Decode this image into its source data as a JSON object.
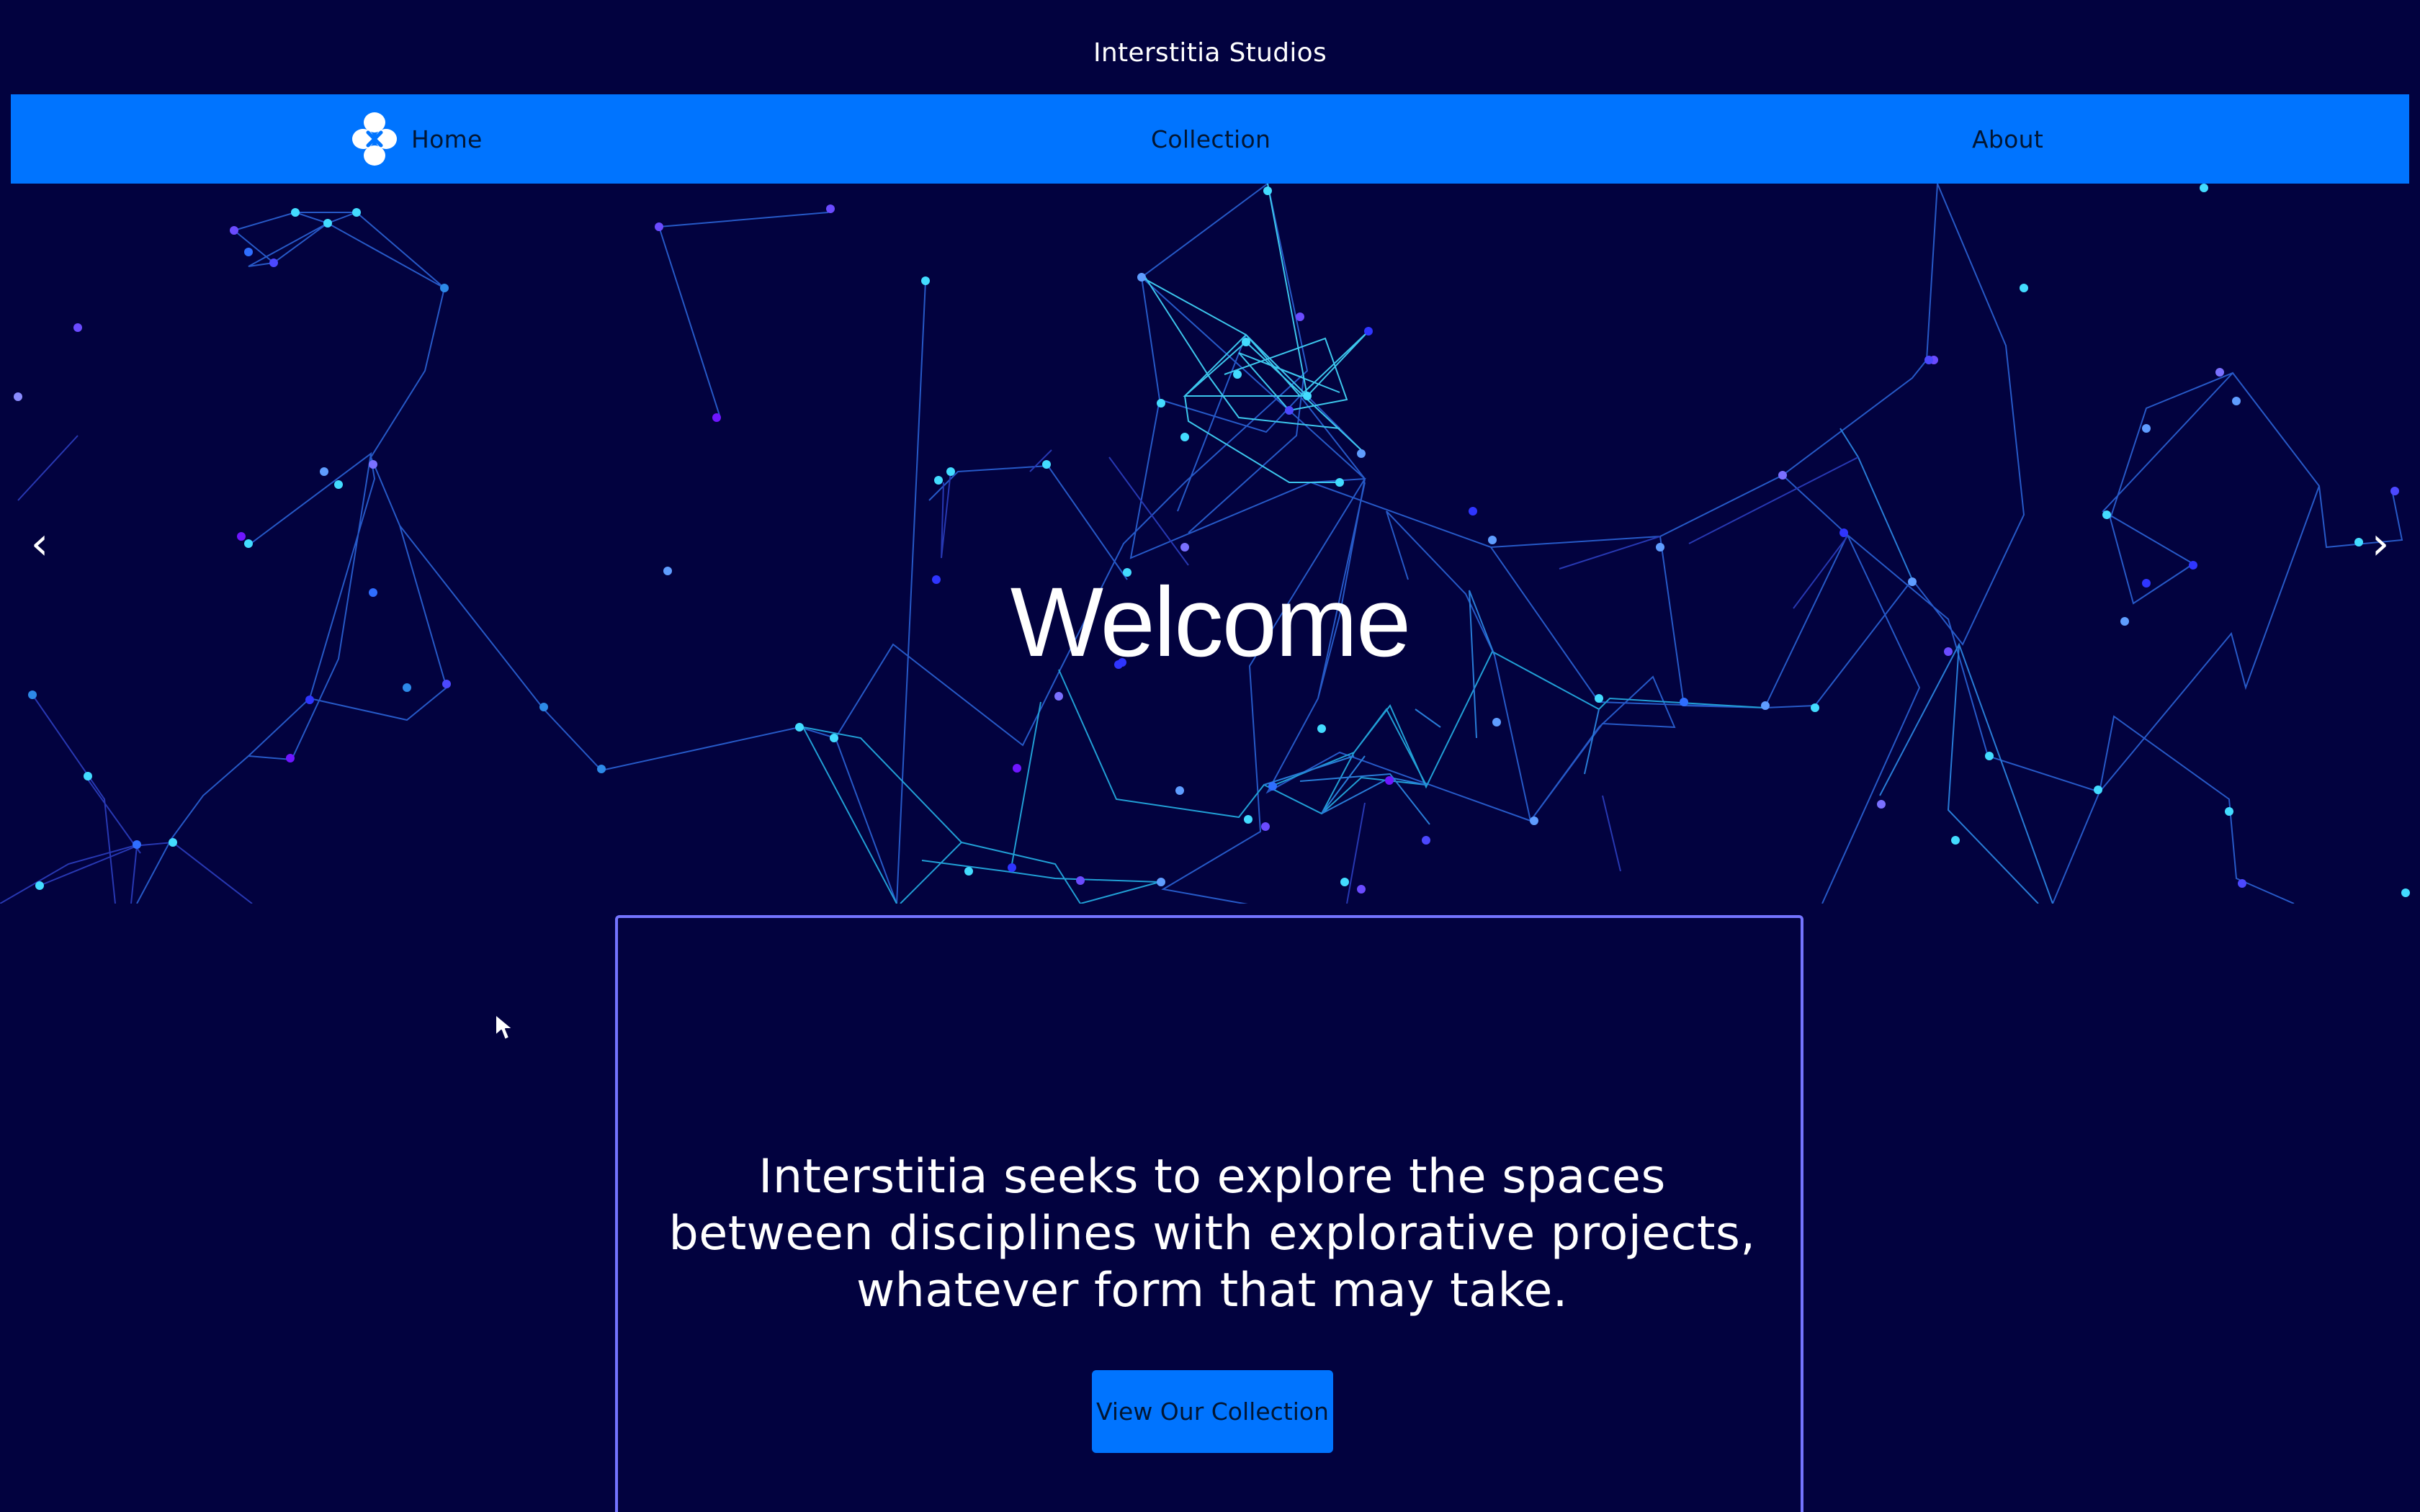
{
  "site": {
    "title": "Interstitia Studios"
  },
  "nav": {
    "items": [
      {
        "label": "Home",
        "icon": "clover-logo-icon"
      },
      {
        "label": "Collection"
      },
      {
        "label": "About"
      }
    ]
  },
  "hero": {
    "title": "Welcome",
    "prev_label": "‹",
    "next_label": "›"
  },
  "intro": {
    "text": "Interstitia seeks to explore the spaces between disciplines with explorative projects, whatever form that may take.",
    "button_label": "View Our Collection"
  },
  "colors": {
    "background": "#02023f",
    "nav": "#0074ff",
    "card_border": "#7474ff",
    "network_primary": "#43dcff",
    "network_secondary": "#5f4bff"
  }
}
